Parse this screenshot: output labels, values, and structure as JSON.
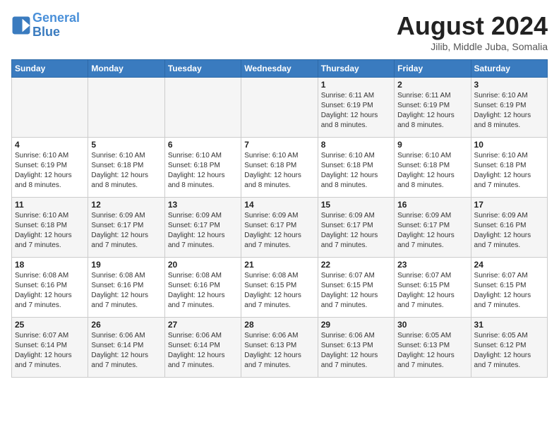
{
  "header": {
    "logo_line1": "General",
    "logo_line2": "Blue",
    "title": "August 2024",
    "subtitle": "Jilib, Middle Juba, Somalia"
  },
  "days_of_week": [
    "Sunday",
    "Monday",
    "Tuesday",
    "Wednesday",
    "Thursday",
    "Friday",
    "Saturday"
  ],
  "weeks": [
    [
      {
        "day": "",
        "info": ""
      },
      {
        "day": "",
        "info": ""
      },
      {
        "day": "",
        "info": ""
      },
      {
        "day": "",
        "info": ""
      },
      {
        "day": "1",
        "info": "Sunrise: 6:11 AM\nSunset: 6:19 PM\nDaylight: 12 hours and 8 minutes."
      },
      {
        "day": "2",
        "info": "Sunrise: 6:11 AM\nSunset: 6:19 PM\nDaylight: 12 hours and 8 minutes."
      },
      {
        "day": "3",
        "info": "Sunrise: 6:10 AM\nSunset: 6:19 PM\nDaylight: 12 hours and 8 minutes."
      }
    ],
    [
      {
        "day": "4",
        "info": "Sunrise: 6:10 AM\nSunset: 6:19 PM\nDaylight: 12 hours and 8 minutes."
      },
      {
        "day": "5",
        "info": "Sunrise: 6:10 AM\nSunset: 6:18 PM\nDaylight: 12 hours and 8 minutes."
      },
      {
        "day": "6",
        "info": "Sunrise: 6:10 AM\nSunset: 6:18 PM\nDaylight: 12 hours and 8 minutes."
      },
      {
        "day": "7",
        "info": "Sunrise: 6:10 AM\nSunset: 6:18 PM\nDaylight: 12 hours and 8 minutes."
      },
      {
        "day": "8",
        "info": "Sunrise: 6:10 AM\nSunset: 6:18 PM\nDaylight: 12 hours and 8 minutes."
      },
      {
        "day": "9",
        "info": "Sunrise: 6:10 AM\nSunset: 6:18 PM\nDaylight: 12 hours and 8 minutes."
      },
      {
        "day": "10",
        "info": "Sunrise: 6:10 AM\nSunset: 6:18 PM\nDaylight: 12 hours and 7 minutes."
      }
    ],
    [
      {
        "day": "11",
        "info": "Sunrise: 6:10 AM\nSunset: 6:18 PM\nDaylight: 12 hours and 7 minutes."
      },
      {
        "day": "12",
        "info": "Sunrise: 6:09 AM\nSunset: 6:17 PM\nDaylight: 12 hours and 7 minutes."
      },
      {
        "day": "13",
        "info": "Sunrise: 6:09 AM\nSunset: 6:17 PM\nDaylight: 12 hours and 7 minutes."
      },
      {
        "day": "14",
        "info": "Sunrise: 6:09 AM\nSunset: 6:17 PM\nDaylight: 12 hours and 7 minutes."
      },
      {
        "day": "15",
        "info": "Sunrise: 6:09 AM\nSunset: 6:17 PM\nDaylight: 12 hours and 7 minutes."
      },
      {
        "day": "16",
        "info": "Sunrise: 6:09 AM\nSunset: 6:17 PM\nDaylight: 12 hours and 7 minutes."
      },
      {
        "day": "17",
        "info": "Sunrise: 6:09 AM\nSunset: 6:16 PM\nDaylight: 12 hours and 7 minutes."
      }
    ],
    [
      {
        "day": "18",
        "info": "Sunrise: 6:08 AM\nSunset: 6:16 PM\nDaylight: 12 hours and 7 minutes."
      },
      {
        "day": "19",
        "info": "Sunrise: 6:08 AM\nSunset: 6:16 PM\nDaylight: 12 hours and 7 minutes."
      },
      {
        "day": "20",
        "info": "Sunrise: 6:08 AM\nSunset: 6:16 PM\nDaylight: 12 hours and 7 minutes."
      },
      {
        "day": "21",
        "info": "Sunrise: 6:08 AM\nSunset: 6:15 PM\nDaylight: 12 hours and 7 minutes."
      },
      {
        "day": "22",
        "info": "Sunrise: 6:07 AM\nSunset: 6:15 PM\nDaylight: 12 hours and 7 minutes."
      },
      {
        "day": "23",
        "info": "Sunrise: 6:07 AM\nSunset: 6:15 PM\nDaylight: 12 hours and 7 minutes."
      },
      {
        "day": "24",
        "info": "Sunrise: 6:07 AM\nSunset: 6:15 PM\nDaylight: 12 hours and 7 minutes."
      }
    ],
    [
      {
        "day": "25",
        "info": "Sunrise: 6:07 AM\nSunset: 6:14 PM\nDaylight: 12 hours and 7 minutes."
      },
      {
        "day": "26",
        "info": "Sunrise: 6:06 AM\nSunset: 6:14 PM\nDaylight: 12 hours and 7 minutes."
      },
      {
        "day": "27",
        "info": "Sunrise: 6:06 AM\nSunset: 6:14 PM\nDaylight: 12 hours and 7 minutes."
      },
      {
        "day": "28",
        "info": "Sunrise: 6:06 AM\nSunset: 6:13 PM\nDaylight: 12 hours and 7 minutes."
      },
      {
        "day": "29",
        "info": "Sunrise: 6:06 AM\nSunset: 6:13 PM\nDaylight: 12 hours and 7 minutes."
      },
      {
        "day": "30",
        "info": "Sunrise: 6:05 AM\nSunset: 6:13 PM\nDaylight: 12 hours and 7 minutes."
      },
      {
        "day": "31",
        "info": "Sunrise: 6:05 AM\nSunset: 6:12 PM\nDaylight: 12 hours and 7 minutes."
      }
    ]
  ]
}
